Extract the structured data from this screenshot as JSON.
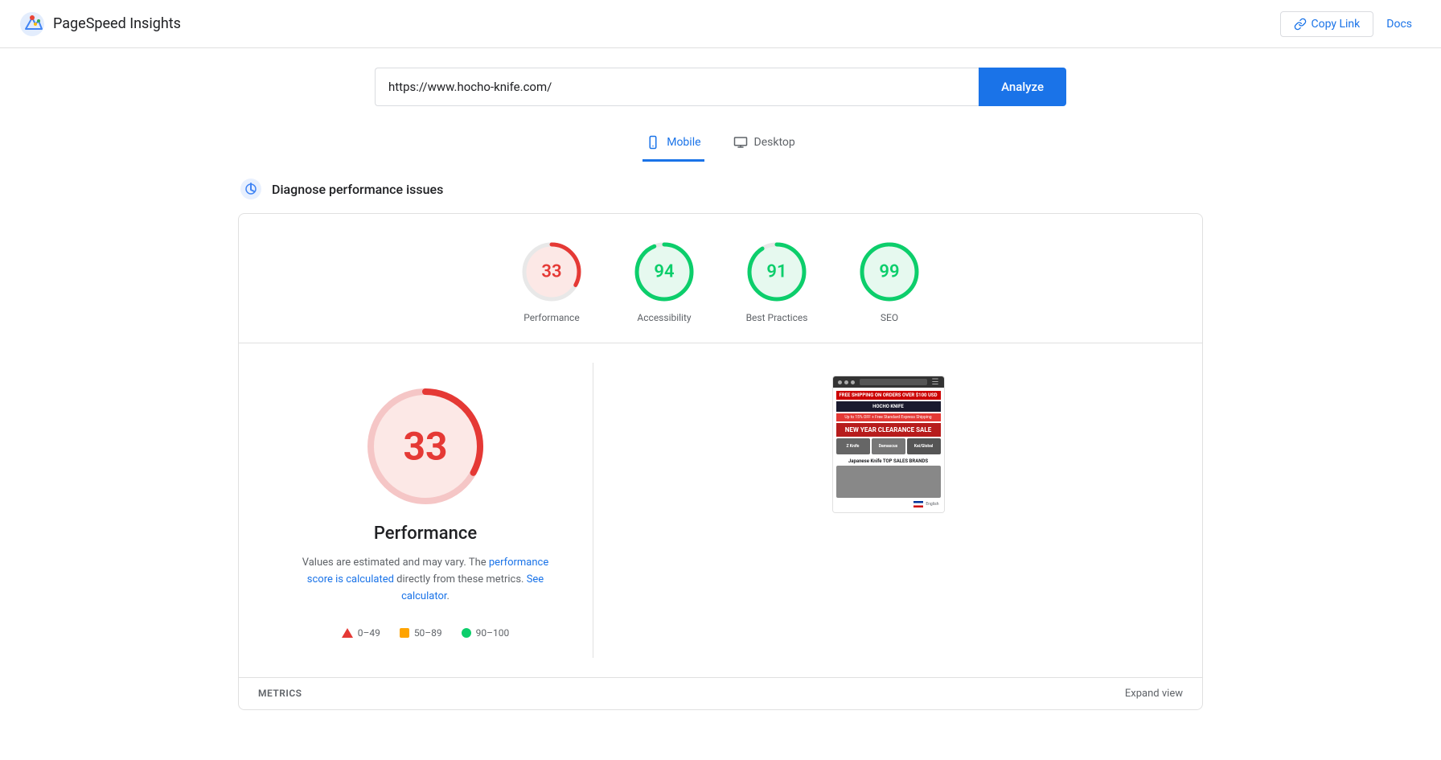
{
  "header": {
    "title": "PageSpeed Insights",
    "copy_link_label": "Copy Link",
    "docs_label": "Docs"
  },
  "search": {
    "url_value": "https://www.hocho-knife.com/",
    "analyze_label": "Analyze"
  },
  "tabs": [
    {
      "id": "mobile",
      "label": "Mobile",
      "active": true
    },
    {
      "id": "desktop",
      "label": "Desktop",
      "active": false
    }
  ],
  "diagnose": {
    "title": "Diagnose performance issues"
  },
  "scores": [
    {
      "id": "performance",
      "value": "33",
      "label": "Performance",
      "color": "#e53935",
      "bg": "#fce8e6",
      "ring": "#e53935",
      "pct": 33
    },
    {
      "id": "accessibility",
      "value": "94",
      "label": "Accessibility",
      "color": "#0cce6b",
      "bg": "#e6f9ef",
      "ring": "#0cce6b",
      "pct": 94
    },
    {
      "id": "best-practices",
      "value": "91",
      "label": "Best Practices",
      "color": "#0cce6b",
      "bg": "#e6f9ef",
      "ring": "#0cce6b",
      "pct": 91
    },
    {
      "id": "seo",
      "value": "99",
      "label": "SEO",
      "color": "#0cce6b",
      "bg": "#e6f9ef",
      "ring": "#0cce6b",
      "pct": 99
    }
  ],
  "performance_detail": {
    "score": "33",
    "title": "Performance",
    "desc_plain": "Values are estimated and may vary. The ",
    "desc_link1": "performance score is calculated",
    "desc_mid": " directly from these metrics. ",
    "desc_link2": "See calculator",
    "desc_end": "."
  },
  "legend": [
    {
      "id": "fail",
      "range": "0–49",
      "shape": "triangle",
      "color": "#e53935"
    },
    {
      "id": "average",
      "range": "50–89",
      "shape": "square",
      "color": "#ffa400"
    },
    {
      "id": "pass",
      "range": "90–100",
      "shape": "circle",
      "color": "#0cce6b"
    }
  ],
  "metrics_footer": {
    "metrics_label": "METRICS",
    "expand_label": "Expand view"
  },
  "screenshot": {
    "banner_text": "FREE SHIPPING ON ORDERS OVER $100 USD",
    "nav_text": "HOCHO KNIFE",
    "promo_text": "Up to 15% OFF + Free Standard Express Shipping",
    "sale_text": "NEW YEAR CLEARANCE SALE",
    "cat1": "Z Knife",
    "cat2": "Damascus",
    "cat3": "Kai/Global",
    "section_title": "Japanese Knife TOP SALES BRANDS",
    "lang_text": "English"
  }
}
